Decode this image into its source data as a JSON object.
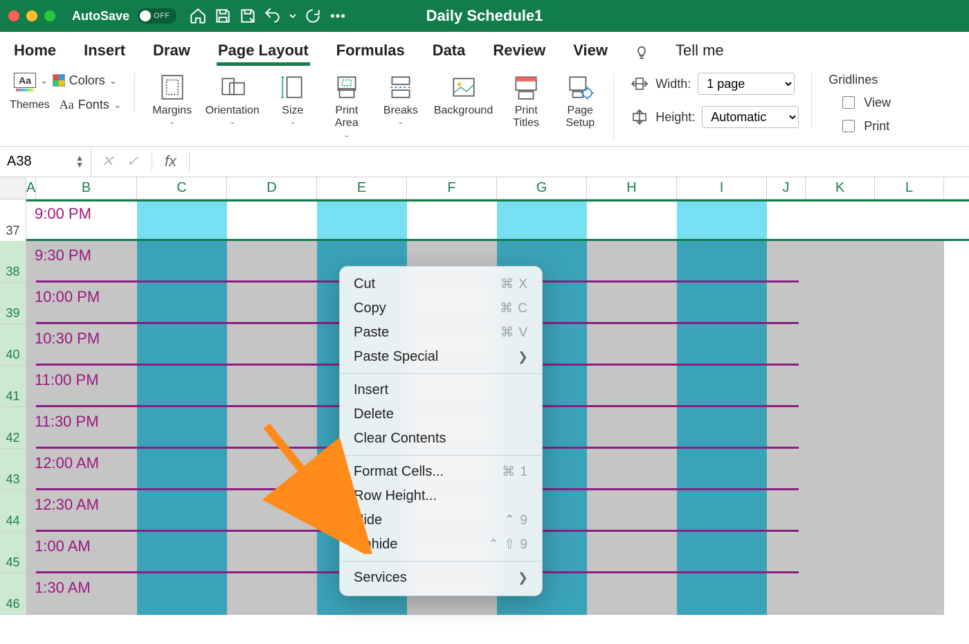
{
  "titlebar": {
    "autosave_label": "AutoSave",
    "autosave_state": "OFF",
    "title": "Daily Schedule1"
  },
  "tabs": [
    "Home",
    "Insert",
    "Draw",
    "Page Layout",
    "Formulas",
    "Data",
    "Review",
    "View"
  ],
  "active_tab": "Page Layout",
  "tellme": "Tell me",
  "ribbon": {
    "themes": "Themes",
    "colors": "Colors",
    "fonts": "Fonts",
    "margins": "Margins",
    "orientation": "Orientation",
    "size": "Size",
    "print_area": "Print\nArea",
    "breaks": "Breaks",
    "background": "Background",
    "print_titles": "Print\nTitles",
    "page_setup": "Page\nSetup",
    "width": "Width:",
    "height": "Height:",
    "width_val": "1 page",
    "height_val": "Automatic",
    "gridlines": "Gridlines",
    "view": "View",
    "print": "Print"
  },
  "formula_bar": {
    "cell_ref": "A38"
  },
  "columns": [
    "A",
    "B",
    "C",
    "D",
    "E",
    "F",
    "G",
    "H",
    "I",
    "J",
    "K",
    "L"
  ],
  "rows": [
    {
      "num": "37",
      "time": "9:00 PM",
      "selected": false
    },
    {
      "num": "38",
      "time": "9:30 PM",
      "selected": true
    },
    {
      "num": "39",
      "time": "10:00 PM",
      "selected": true
    },
    {
      "num": "40",
      "time": "10:30 PM",
      "selected": true
    },
    {
      "num": "41",
      "time": "11:00 PM",
      "selected": true
    },
    {
      "num": "42",
      "time": "11:30 PM",
      "selected": true
    },
    {
      "num": "43",
      "time": "12:00 AM",
      "selected": true
    },
    {
      "num": "44",
      "time": "12:30 AM",
      "selected": true
    },
    {
      "num": "45",
      "time": "1:00 AM",
      "selected": true
    },
    {
      "num": "46",
      "time": "1:30 AM",
      "selected": true
    }
  ],
  "context_menu": {
    "cut": {
      "label": "Cut",
      "shortcut": "⌘ X"
    },
    "copy": {
      "label": "Copy",
      "shortcut": "⌘ C"
    },
    "paste": {
      "label": "Paste",
      "shortcut": "⌘ V"
    },
    "paste_special": {
      "label": "Paste Special"
    },
    "insert": {
      "label": "Insert"
    },
    "delete": {
      "label": "Delete"
    },
    "clear": {
      "label": "Clear Contents"
    },
    "format": {
      "label": "Format Cells...",
      "shortcut": "⌘ 1"
    },
    "row_height": {
      "label": "Row Height..."
    },
    "hide": {
      "label": "Hide",
      "shortcut": "⌃ 9"
    },
    "unhide": {
      "label": "Unhide",
      "shortcut": "⌃ ⇧ 9"
    },
    "services": {
      "label": "Services"
    }
  }
}
